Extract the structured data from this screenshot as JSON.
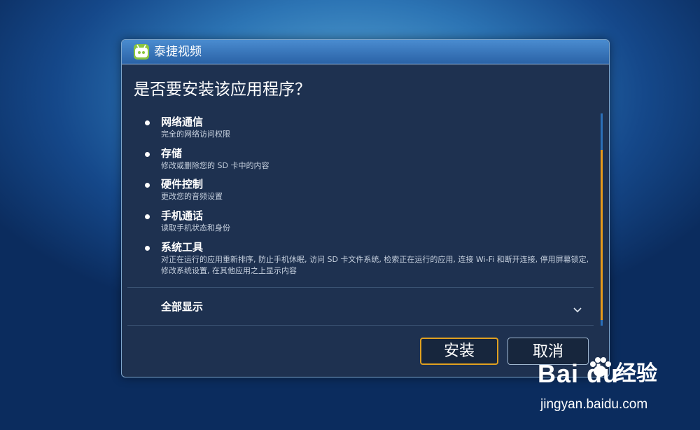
{
  "dialog": {
    "app_title": "泰捷视频",
    "question": "是否要安装该应用程序？",
    "permissions": [
      {
        "title": "网络通信",
        "desc": "完全的网络访问权限"
      },
      {
        "title": "存储",
        "desc": "修改或删除您的 SD 卡中的内容"
      },
      {
        "title": "硬件控制",
        "desc": "更改您的音频设置"
      },
      {
        "title": "手机通话",
        "desc": "读取手机状态和身份"
      },
      {
        "title": "系统工具",
        "desc": "对正在运行的应用重新排序, 防止手机休眠, 访问 SD 卡文件系统, 检索正在运行的应用, 连接 Wi-Fi 和断开连接, 停用屏幕锁定, 修改系统设置, 在其他应用之上显示内容"
      }
    ],
    "show_all_label": "全部显示",
    "install_label": "安装",
    "cancel_label": "取消"
  },
  "watermark": {
    "logo_text": "Bai du",
    "jingyan": "经验",
    "url": "jingyan.baidu.com"
  },
  "colors": {
    "accent_focus": "#e0a020",
    "scroll_thumb": "#e89a1a",
    "app_icon": "#8cc63f"
  },
  "icons": {
    "app": "tv-robot-icon",
    "expand": "chevron-down-icon",
    "paw": "paw-icon"
  }
}
